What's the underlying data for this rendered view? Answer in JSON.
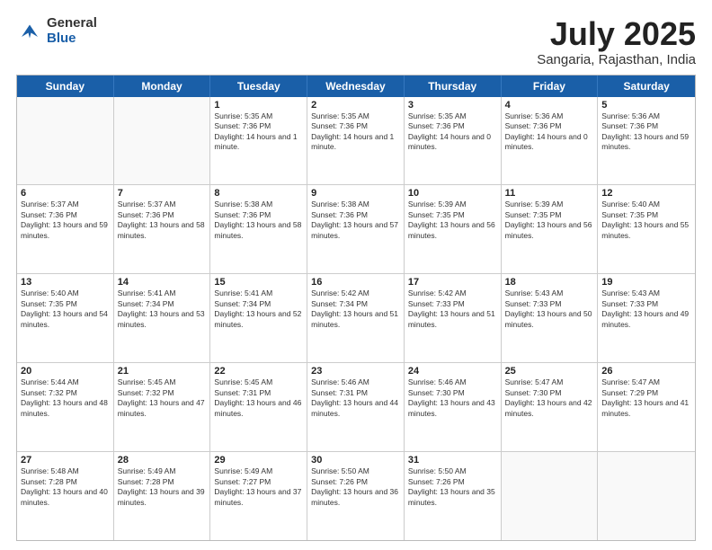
{
  "logo": {
    "general": "General",
    "blue": "Blue"
  },
  "title": "July 2025",
  "subtitle": "Sangaria, Rajasthan, India",
  "headers": [
    "Sunday",
    "Monday",
    "Tuesday",
    "Wednesday",
    "Thursday",
    "Friday",
    "Saturday"
  ],
  "rows": [
    [
      {
        "day": "",
        "info": ""
      },
      {
        "day": "",
        "info": ""
      },
      {
        "day": "1",
        "info": "Sunrise: 5:35 AM\nSunset: 7:36 PM\nDaylight: 14 hours and 1 minute."
      },
      {
        "day": "2",
        "info": "Sunrise: 5:35 AM\nSunset: 7:36 PM\nDaylight: 14 hours and 1 minute."
      },
      {
        "day": "3",
        "info": "Sunrise: 5:35 AM\nSunset: 7:36 PM\nDaylight: 14 hours and 0 minutes."
      },
      {
        "day": "4",
        "info": "Sunrise: 5:36 AM\nSunset: 7:36 PM\nDaylight: 14 hours and 0 minutes."
      },
      {
        "day": "5",
        "info": "Sunrise: 5:36 AM\nSunset: 7:36 PM\nDaylight: 13 hours and 59 minutes."
      }
    ],
    [
      {
        "day": "6",
        "info": "Sunrise: 5:37 AM\nSunset: 7:36 PM\nDaylight: 13 hours and 59 minutes."
      },
      {
        "day": "7",
        "info": "Sunrise: 5:37 AM\nSunset: 7:36 PM\nDaylight: 13 hours and 58 minutes."
      },
      {
        "day": "8",
        "info": "Sunrise: 5:38 AM\nSunset: 7:36 PM\nDaylight: 13 hours and 58 minutes."
      },
      {
        "day": "9",
        "info": "Sunrise: 5:38 AM\nSunset: 7:36 PM\nDaylight: 13 hours and 57 minutes."
      },
      {
        "day": "10",
        "info": "Sunrise: 5:39 AM\nSunset: 7:35 PM\nDaylight: 13 hours and 56 minutes."
      },
      {
        "day": "11",
        "info": "Sunrise: 5:39 AM\nSunset: 7:35 PM\nDaylight: 13 hours and 56 minutes."
      },
      {
        "day": "12",
        "info": "Sunrise: 5:40 AM\nSunset: 7:35 PM\nDaylight: 13 hours and 55 minutes."
      }
    ],
    [
      {
        "day": "13",
        "info": "Sunrise: 5:40 AM\nSunset: 7:35 PM\nDaylight: 13 hours and 54 minutes."
      },
      {
        "day": "14",
        "info": "Sunrise: 5:41 AM\nSunset: 7:34 PM\nDaylight: 13 hours and 53 minutes."
      },
      {
        "day": "15",
        "info": "Sunrise: 5:41 AM\nSunset: 7:34 PM\nDaylight: 13 hours and 52 minutes."
      },
      {
        "day": "16",
        "info": "Sunrise: 5:42 AM\nSunset: 7:34 PM\nDaylight: 13 hours and 51 minutes."
      },
      {
        "day": "17",
        "info": "Sunrise: 5:42 AM\nSunset: 7:33 PM\nDaylight: 13 hours and 51 minutes."
      },
      {
        "day": "18",
        "info": "Sunrise: 5:43 AM\nSunset: 7:33 PM\nDaylight: 13 hours and 50 minutes."
      },
      {
        "day": "19",
        "info": "Sunrise: 5:43 AM\nSunset: 7:33 PM\nDaylight: 13 hours and 49 minutes."
      }
    ],
    [
      {
        "day": "20",
        "info": "Sunrise: 5:44 AM\nSunset: 7:32 PM\nDaylight: 13 hours and 48 minutes."
      },
      {
        "day": "21",
        "info": "Sunrise: 5:45 AM\nSunset: 7:32 PM\nDaylight: 13 hours and 47 minutes."
      },
      {
        "day": "22",
        "info": "Sunrise: 5:45 AM\nSunset: 7:31 PM\nDaylight: 13 hours and 46 minutes."
      },
      {
        "day": "23",
        "info": "Sunrise: 5:46 AM\nSunset: 7:31 PM\nDaylight: 13 hours and 44 minutes."
      },
      {
        "day": "24",
        "info": "Sunrise: 5:46 AM\nSunset: 7:30 PM\nDaylight: 13 hours and 43 minutes."
      },
      {
        "day": "25",
        "info": "Sunrise: 5:47 AM\nSunset: 7:30 PM\nDaylight: 13 hours and 42 minutes."
      },
      {
        "day": "26",
        "info": "Sunrise: 5:47 AM\nSunset: 7:29 PM\nDaylight: 13 hours and 41 minutes."
      }
    ],
    [
      {
        "day": "27",
        "info": "Sunrise: 5:48 AM\nSunset: 7:28 PM\nDaylight: 13 hours and 40 minutes."
      },
      {
        "day": "28",
        "info": "Sunrise: 5:49 AM\nSunset: 7:28 PM\nDaylight: 13 hours and 39 minutes."
      },
      {
        "day": "29",
        "info": "Sunrise: 5:49 AM\nSunset: 7:27 PM\nDaylight: 13 hours and 37 minutes."
      },
      {
        "day": "30",
        "info": "Sunrise: 5:50 AM\nSunset: 7:26 PM\nDaylight: 13 hours and 36 minutes."
      },
      {
        "day": "31",
        "info": "Sunrise: 5:50 AM\nSunset: 7:26 PM\nDaylight: 13 hours and 35 minutes."
      },
      {
        "day": "",
        "info": ""
      },
      {
        "day": "",
        "info": ""
      }
    ]
  ]
}
